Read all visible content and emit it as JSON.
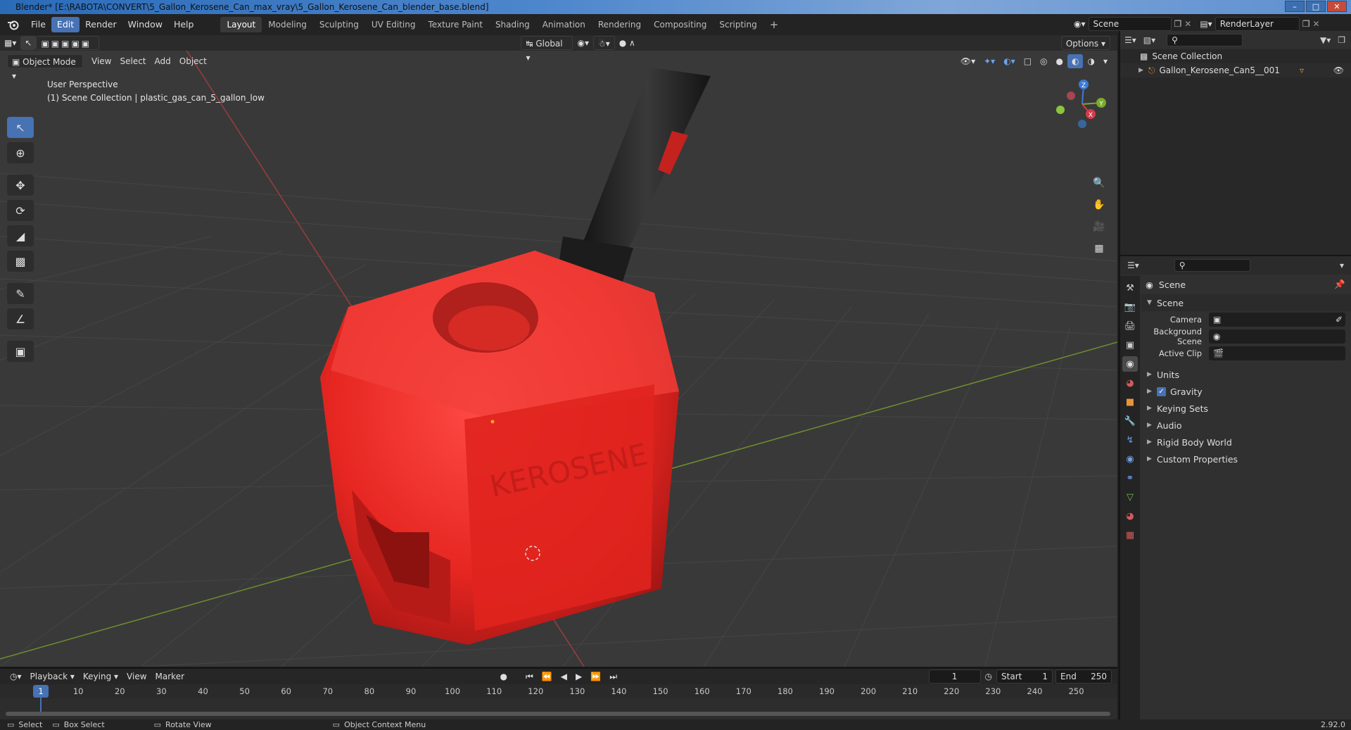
{
  "window": {
    "title": "Blender* [E:\\RABOTA\\CONVERT\\5_Gallon_Kerosene_Can_max_vray\\5_Gallon_Kerosene_Can_blender_base.blend]"
  },
  "menu": {
    "items": [
      "File",
      "Edit",
      "Render",
      "Window",
      "Help"
    ],
    "active": "Edit"
  },
  "workspaces": [
    "Layout",
    "Modeling",
    "Sculpting",
    "UV Editing",
    "Texture Paint",
    "Shading",
    "Animation",
    "Rendering",
    "Compositing",
    "Scripting"
  ],
  "active_workspace": "Layout",
  "scene_field": "Scene",
  "renderlayer_field": "RenderLayer",
  "viewport": {
    "mode": "Object Mode",
    "header_menus": [
      "View",
      "Select",
      "Add",
      "Object"
    ],
    "transform_orientation": "Global",
    "options_label": "Options",
    "info_line1": "User Perspective",
    "info_line2": "(1) Scene Collection | plastic_gas_can_5_gallon_low",
    "gizmo_axes": [
      "X",
      "Y",
      "Z"
    ]
  },
  "outliner": {
    "root": "Scene Collection",
    "items": [
      {
        "label": "Gallon_Kerosene_Can5__001"
      }
    ]
  },
  "properties": {
    "context": "Scene",
    "panel": "Scene",
    "fields": [
      {
        "label": "Camera",
        "value": ""
      },
      {
        "label": "Background Scene",
        "value": ""
      },
      {
        "label": "Active Clip",
        "value": ""
      }
    ],
    "subpanels": [
      "Units",
      "Gravity",
      "Keying Sets",
      "Audio",
      "Rigid Body World",
      "Custom Properties"
    ],
    "gravity_checked": true
  },
  "timeline": {
    "menus": [
      "Playback",
      "Keying",
      "View",
      "Marker"
    ],
    "current_frame": "1",
    "start_label": "Start",
    "start": "1",
    "end_label": "End",
    "end": "250",
    "ticks": [
      "10",
      "20",
      "30",
      "40",
      "50",
      "60",
      "70",
      "80",
      "90",
      "100",
      "110",
      "120",
      "130",
      "140",
      "150",
      "160",
      "170",
      "180",
      "190",
      "200",
      "210",
      "220",
      "230",
      "240",
      "250"
    ]
  },
  "statusbar": {
    "select": "Select",
    "box_select": "Box Select",
    "rotate_view": "Rotate View",
    "context_menu": "Object Context Menu",
    "version": "2.92.0"
  }
}
